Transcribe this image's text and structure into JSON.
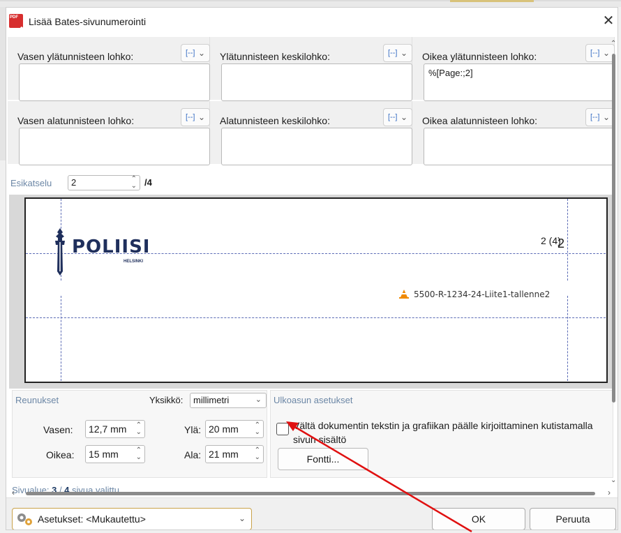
{
  "window": {
    "title": "Lisää Bates-sivunumerointi",
    "icon_text": "PDF"
  },
  "header_footer": {
    "top": [
      {
        "label": "Vasen ylätunnisteen lohko:",
        "value": ""
      },
      {
        "label": "Ylätunnisteen keskilohko:",
        "value": ""
      },
      {
        "label": "Oikea ylätunnisteen lohko:",
        "value": "%[Page:;2]"
      }
    ],
    "bottom": [
      {
        "label": "Vasen alatunnisteen lohko:",
        "value": ""
      },
      {
        "label": "Alatunnisteen keskilohko:",
        "value": ""
      },
      {
        "label": "Oikea alatunnisteen lohko:",
        "value": ""
      }
    ],
    "macro_icon": "[--]",
    "chevron": "⌄"
  },
  "preview": {
    "label": "Esikatselu",
    "page": "2",
    "total": "/4",
    "logo_text": "POLIISI",
    "logo_sub": "HELSINKI",
    "page_number_small": "2 (4)",
    "page_number_big": "2",
    "doc_id": "5500-R-1234-24-Liite1-tallenne2"
  },
  "margins": {
    "header": "Reunukset",
    "unit_label": "Yksikkö:",
    "unit_value": "millimetri",
    "left_label": "Vasen:",
    "left_value": "12,7 mm",
    "right_label": "Oikea:",
    "right_value": "15 mm",
    "top_label": "Ylä:",
    "top_value": "20 mm",
    "bottom_label": "Ala:",
    "bottom_value": "21 mm"
  },
  "appearance": {
    "header": "Ulkoasun asetukset",
    "checkbox_label": "Vältä dokumentin tekstin ja grafiikan päälle kirjoittaminen kutistamalla sivun sisältö",
    "checkbox_checked": false,
    "font_button": "Fontti..."
  },
  "status": {
    "prefix": "Sivualue: ",
    "selected": "3",
    "sep": " / ",
    "total": "4",
    "suffix": " sivua valittu"
  },
  "footer": {
    "settings_label": "Asetukset: <Mukautettu>",
    "ok": "OK",
    "cancel": "Peruuta"
  },
  "colors": {
    "annotation_arrow": "#e01010",
    "guide_lines": "#5b6bb5",
    "logo_navy": "#1f2f5c"
  }
}
